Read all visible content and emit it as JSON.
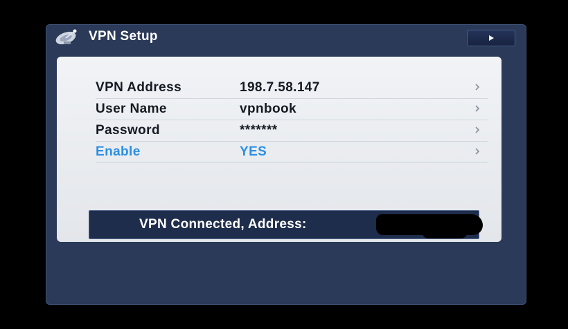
{
  "window": {
    "title": "VPN Setup",
    "title_icon": "satellite-dish-icon",
    "nav_button_icon": "play-right-icon"
  },
  "settings": {
    "rows": [
      {
        "label": "VPN Address",
        "value": "198.7.58.147",
        "active": false
      },
      {
        "label": "User Name",
        "value": "vpnbook",
        "active": false
      },
      {
        "label": "Password",
        "value": "*******",
        "active": false
      },
      {
        "label": "Enable",
        "value": "YES",
        "active": true
      }
    ]
  },
  "status": {
    "text": "VPN Connected, Address:"
  },
  "colors": {
    "frame": "#2a3a58",
    "panel": "#eceef1",
    "highlight": "#2b8fe3",
    "status_bar": "#1f2d4c"
  }
}
